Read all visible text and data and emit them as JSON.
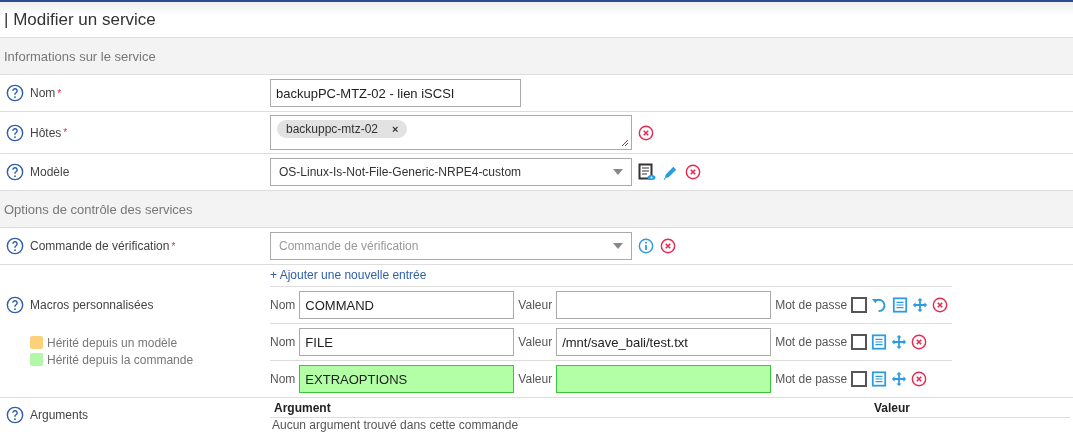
{
  "page_title": "| Modifier un service",
  "sections": [
    {
      "title": "Informations sur le service",
      "fields": [
        {
          "kind": "text",
          "label": "Nom",
          "required_mark": "*",
          "value": "backupPC-MTZ-02 - lien iSCSI"
        },
        {
          "kind": "tags",
          "label": "Hôtes",
          "required_mark": "*",
          "tags": [
            "backuppc-mtz-02"
          ],
          "tag_remove": "×"
        },
        {
          "kind": "select",
          "label": "Modèle",
          "value": "OS-Linux-Is-Not-File-Generic-NRPE4-custom"
        }
      ]
    },
    {
      "title": "Options de contrôle des services",
      "fields": [
        {
          "kind": "command",
          "label": "Commande de vérification",
          "required_mark": "*",
          "placeholder": "Commande de vérification"
        }
      ]
    }
  ],
  "macros": {
    "label": "Macros personnalisées",
    "add_link": "+ Ajouter une nouvelle entrée",
    "legend": [
      {
        "label": "Hérité depuis un modèle",
        "color": "#fdd17a"
      },
      {
        "label": "Hérité depuis la commande",
        "color": "#b3f7a9"
      }
    ],
    "rows": [
      {
        "name_label": "Nom",
        "name": "COMMAND",
        "value_label": "Valeur",
        "value": "",
        "password_label": "Mot de passe",
        "inherited_from_command": false,
        "password": false,
        "resettable": true
      },
      {
        "name_label": "Nom",
        "name": "FILE",
        "value_label": "Valeur",
        "value": "/mnt/save_bali/test.txt",
        "password_label": "Mot de passe",
        "inherited_from_command": false,
        "password": false,
        "resettable": false
      },
      {
        "name_label": "Nom",
        "name": "EXTRAOPTIONS",
        "value_label": "Valeur",
        "value": "",
        "password_label": "Mot de passe",
        "inherited_from_command": true,
        "password": false,
        "resettable": false
      }
    ]
  },
  "arguments": {
    "label": "Arguments",
    "columns": [
      "Argument",
      "Valeur"
    ],
    "empty": "Aucun argument trouvé dans cette commande"
  }
}
